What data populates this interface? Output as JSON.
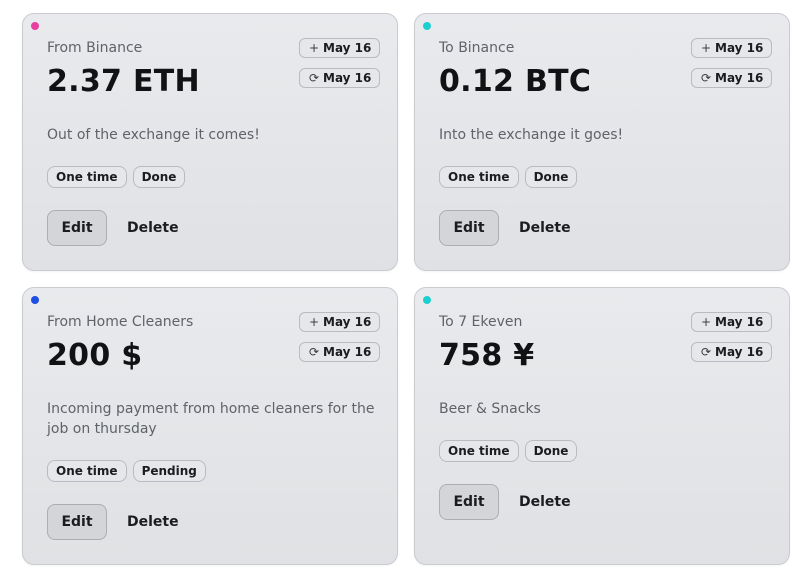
{
  "cards": [
    {
      "dot_color": "#e83ea0",
      "counterparty": "From Binance",
      "amount": "2.37 ETH",
      "created": "May 16",
      "next": "May 16",
      "description": "Out of the exchange it comes!",
      "frequency": "One time",
      "status": "Done",
      "edit_label": "Edit",
      "delete_label": "Delete"
    },
    {
      "dot_color": "#1ecfcf",
      "counterparty": "To Binance",
      "amount": "0.12 BTC",
      "created": "May 16",
      "next": "May 16",
      "description": "Into the exchange it goes!",
      "frequency": "One time",
      "status": "Done",
      "edit_label": "Edit",
      "delete_label": "Delete"
    },
    {
      "dot_color": "#1f4fe6",
      "counterparty": "From Home Cleaners",
      "amount": "200 $",
      "created": "May 16",
      "next": "May 16",
      "description": "Incoming payment from home cleaners for the job on thursday",
      "frequency": "One time",
      "status": "Pending",
      "edit_label": "Edit",
      "delete_label": "Delete"
    },
    {
      "dot_color": "#1ecfcf",
      "counterparty": "To 7 Ekeven",
      "amount": "758 ¥",
      "created": "May 16",
      "next": "May 16",
      "description": "Beer & Snacks",
      "frequency": "One time",
      "status": "Done",
      "edit_label": "Edit",
      "delete_label": "Delete"
    }
  ],
  "icons": {
    "created": "plus-icon",
    "next": "refresh-icon"
  }
}
